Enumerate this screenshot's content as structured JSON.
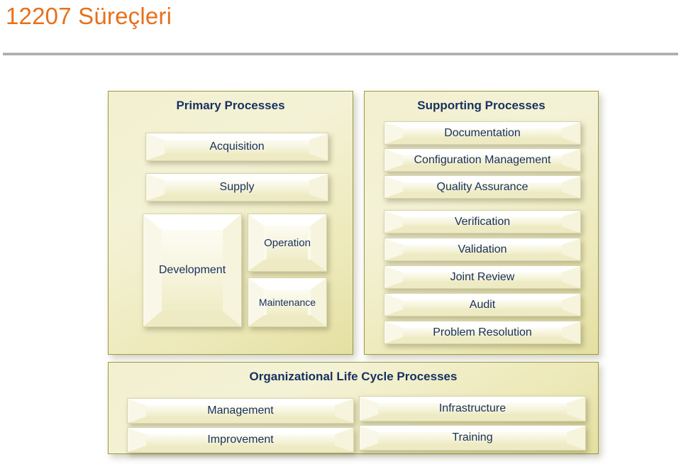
{
  "slide": {
    "title": "12207 Süreçleri",
    "title_color": "#E8701A",
    "rule_color": "#ACACAC",
    "heading_color": "#17305F",
    "panel_fill": "#F2F0CF",
    "panel_border": "#9C9A3F",
    "box_fill": "#FBFAEE"
  },
  "panels": {
    "primary": {
      "title": "Primary Processes",
      "boxes": [
        {
          "label": "Acquisition"
        },
        {
          "label": "Supply"
        },
        {
          "label": "Development"
        },
        {
          "label": "Operation"
        },
        {
          "label": "Maintenance"
        }
      ]
    },
    "supporting": {
      "title": "Supporting Processes",
      "boxes": [
        {
          "label": "Documentation"
        },
        {
          "label": "Configuration Management"
        },
        {
          "label": "Quality Assurance"
        },
        {
          "label": "Verification"
        },
        {
          "label": "Validation"
        },
        {
          "label": "Joint Review"
        },
        {
          "label": "Audit"
        },
        {
          "label": "Problem Resolution"
        }
      ]
    },
    "organizational": {
      "title": "Organizational Life Cycle Processes",
      "boxes": [
        {
          "label": "Management"
        },
        {
          "label": "Improvement"
        },
        {
          "label": "Infrastructure"
        },
        {
          "label": "Training"
        }
      ]
    }
  }
}
